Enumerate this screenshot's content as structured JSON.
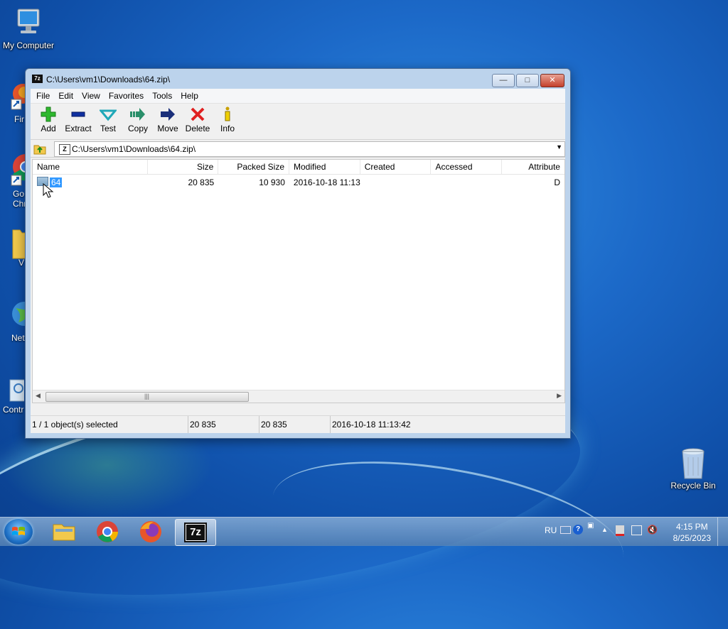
{
  "desktop": {
    "icons": [
      {
        "label": "My Computer"
      },
      {
        "label": "Recycle Bin"
      }
    ],
    "partial_labels": [
      "Fir",
      "Go",
      "Chr",
      "V",
      "Net",
      "Contr"
    ]
  },
  "window": {
    "title": "C:\\Users\\vm1\\Downloads\\64.zip\\",
    "app_icon_text": "7z",
    "menu": [
      "File",
      "Edit",
      "View",
      "Favorites",
      "Tools",
      "Help"
    ],
    "toolbar": [
      {
        "label": "Add",
        "icon": "plus-icon"
      },
      {
        "label": "Extract",
        "icon": "minus-icon"
      },
      {
        "label": "Test",
        "icon": "check-icon"
      },
      {
        "label": "Copy",
        "icon": "copy-arrow-icon"
      },
      {
        "label": "Move",
        "icon": "move-arrow-icon"
      },
      {
        "label": "Delete",
        "icon": "delete-x-icon"
      },
      {
        "label": "Info",
        "icon": "info-icon"
      }
    ],
    "address": "C:\\Users\\vm1\\Downloads\\64.zip\\",
    "columns": [
      "Name",
      "Size",
      "Packed Size",
      "Modified",
      "Created",
      "Accessed",
      "Attribute"
    ],
    "rows": [
      {
        "name": "64",
        "size": "20 835",
        "packed": "10 930",
        "modified": "2016-10-18 11:13",
        "created": "",
        "accessed": "",
        "attributes": "D"
      }
    ],
    "status": {
      "selection": "1 / 1 object(s) selected",
      "size": "20 835",
      "packed": "20 835",
      "modified": "2016-10-18 11:13:42"
    }
  },
  "taskbar": {
    "language": "RU",
    "time": "4:15 PM",
    "date": "8/25/2023",
    "start_icon": "windows-start-icon",
    "pinned": [
      "explorer-icon",
      "chrome-icon",
      "firefox-icon",
      "7zip-icon"
    ],
    "active_app_label": "7z"
  },
  "colors": {
    "selection": "#3399ff",
    "delete": "#e02020",
    "add": "#2eb82e",
    "extract": "#1030a0"
  }
}
